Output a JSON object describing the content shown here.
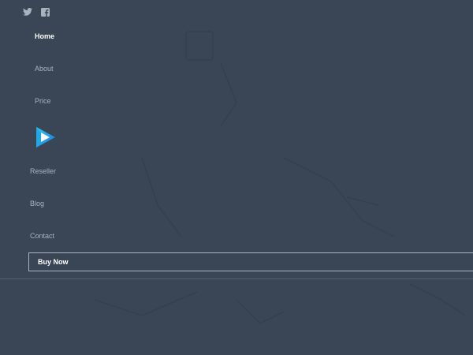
{
  "social": {
    "twitter_icon": "twitter-icon",
    "facebook_icon": "facebook-icon"
  },
  "nav": {
    "items": [
      {
        "label": "Home",
        "active": true
      },
      {
        "label": "About",
        "active": false
      },
      {
        "label": "Price",
        "active": false
      },
      {
        "label": "Reseller",
        "active": false
      },
      {
        "label": "Blog",
        "active": false
      },
      {
        "label": "Contact",
        "active": false
      }
    ],
    "buy_now_label": "Buy Now"
  },
  "logo": {
    "icon": "play-logo-icon"
  },
  "colors": {
    "background": "#3a4656",
    "active_text": "#ffffff",
    "inactive_text": "#a9b2bd",
    "logo_blue": "#1fa7e6",
    "logo_cyan": "#2fd3e8"
  }
}
